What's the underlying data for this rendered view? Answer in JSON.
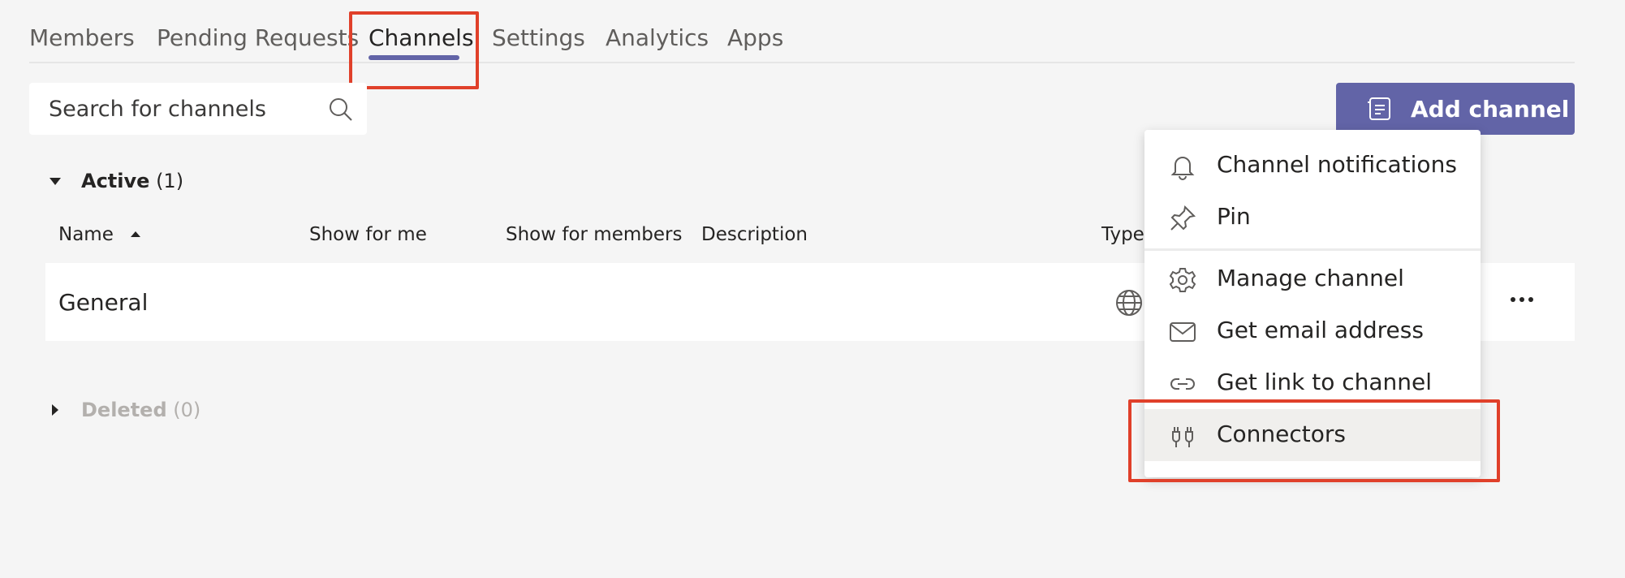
{
  "tabs": [
    {
      "label": "Members"
    },
    {
      "label": "Pending Requests"
    },
    {
      "label": "Channels"
    },
    {
      "label": "Settings"
    },
    {
      "label": "Analytics"
    },
    {
      "label": "Apps"
    }
  ],
  "active_tab": "Channels",
  "search": {
    "placeholder": "Search for channels"
  },
  "add_channel": {
    "label": "Add channel"
  },
  "sections": {
    "active": {
      "label": "Active",
      "count": "(1)"
    },
    "deleted": {
      "label": "Deleted",
      "count": "(0)"
    }
  },
  "columns": {
    "name": "Name",
    "show_for_me": "Show for me",
    "show_for_members": "Show for members",
    "description": "Description",
    "type": "Type"
  },
  "rows": [
    {
      "name": "General",
      "type_icon": "globe-icon"
    }
  ],
  "context_menu": {
    "items": [
      {
        "label": "Channel notifications",
        "icon": "bell-icon"
      },
      {
        "label": "Pin",
        "icon": "pin-icon"
      },
      {
        "label": "Manage channel",
        "icon": "gear-icon"
      },
      {
        "label": "Get email address",
        "icon": "mail-icon"
      },
      {
        "label": "Get link to channel",
        "icon": "link-icon"
      },
      {
        "label": "Connectors",
        "icon": "connectors-icon"
      }
    ],
    "hovered": "Connectors"
  },
  "colors": {
    "accent": "#6264a7",
    "highlight_box": "#e0402a",
    "background": "#f5f5f5"
  }
}
